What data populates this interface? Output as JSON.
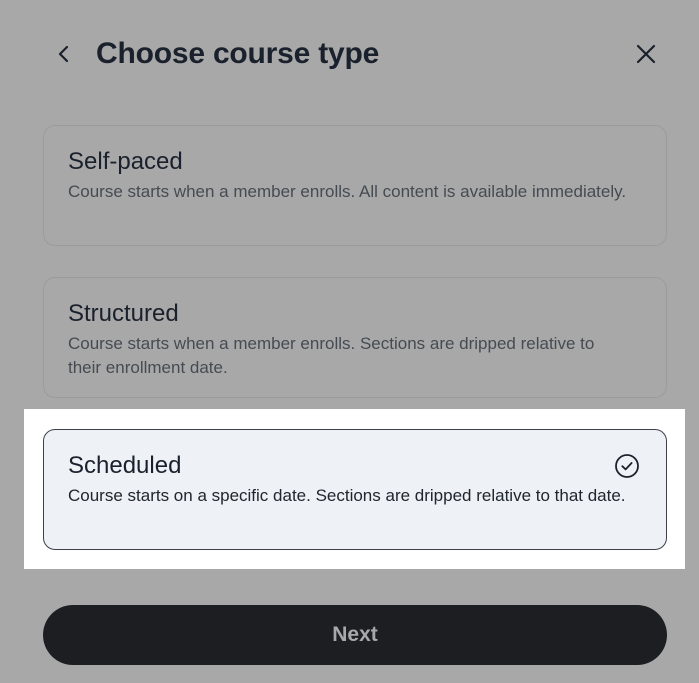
{
  "header": {
    "title": "Choose course type",
    "back_icon": "chevron-left-icon",
    "close_icon": "close-icon"
  },
  "options": [
    {
      "title": "Self-paced",
      "description": "Course starts when a member enrolls. All content is available immediately.",
      "selected": false
    },
    {
      "title": "Structured",
      "description": "Course starts when a member enrolls. Sections are dripped relative to their enrollment date.",
      "selected": false
    },
    {
      "title": "Scheduled",
      "description": "Course starts on a specific date. Sections are dripped relative to that date.",
      "selected": true,
      "selected_icon": "check-circle-icon"
    }
  ],
  "footer": {
    "next_label": "Next"
  },
  "colors": {
    "overlay": "#a8a8a8",
    "title_text": "#1a212c",
    "selected_card_bg": "#eef2f6",
    "button_bg": "#1c1e22",
    "button_text": "#a7a8ab"
  }
}
